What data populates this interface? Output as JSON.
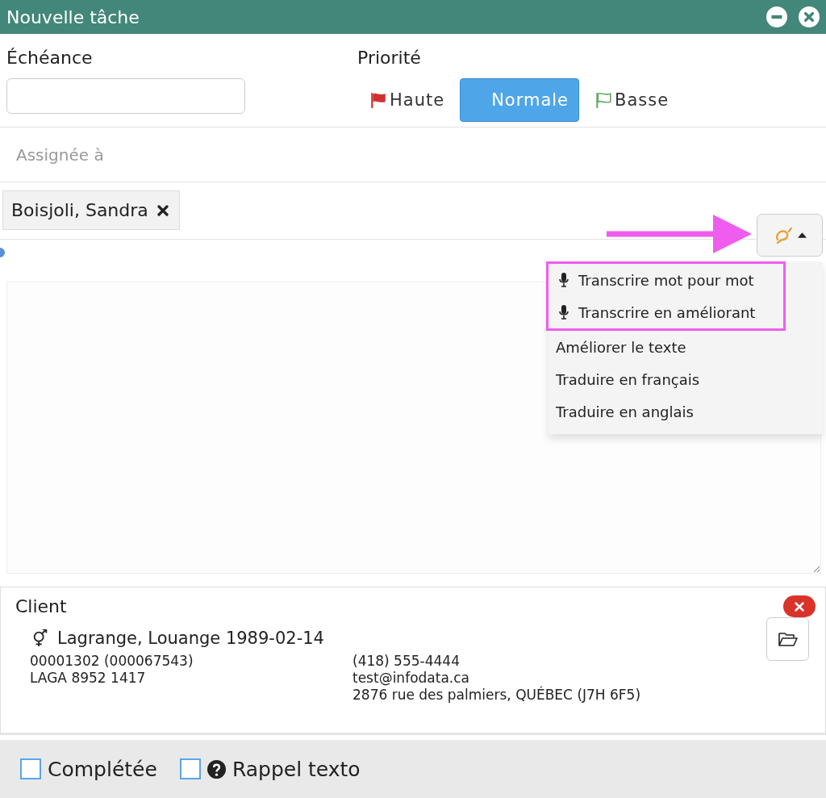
{
  "window": {
    "title": "Nouvelle tâche"
  },
  "due": {
    "label": "Échéance"
  },
  "priority": {
    "label": "Priorité",
    "options": [
      {
        "label": "Haute",
        "kind": "high",
        "selected": false
      },
      {
        "label": "Normale",
        "kind": "normal",
        "selected": true
      },
      {
        "label": "Basse",
        "kind": "low",
        "selected": false
      }
    ]
  },
  "assignee": {
    "placeholder": "Assignée à",
    "tags": [
      {
        "label": "Boisjoli, Sandra"
      }
    ]
  },
  "ai_menu": {
    "expanded": true,
    "annotation_arrow": true,
    "items": [
      {
        "label": "Transcrire mot pour mot",
        "kind": "voice",
        "highlighted": true
      },
      {
        "label": "Transcrire en améliorant",
        "kind": "voice",
        "highlighted": true
      },
      {
        "label": "Améliorer le texte",
        "kind": "text",
        "highlighted": false
      },
      {
        "label": "Traduire en français",
        "kind": "text",
        "highlighted": false
      },
      {
        "label": "Traduire en anglais",
        "kind": "text",
        "highlighted": false
      }
    ]
  },
  "client": {
    "title": "Client",
    "name": "Lagrange, Louange 1989-02-14",
    "left_lines": [
      "00001302 (000067543)",
      "LAGA 8952 1417"
    ],
    "right_lines": [
      "(418) 555-4444",
      "test@infodata.ca",
      "2876 rue des palmiers, QUÉBEC (J7H 6F5)"
    ]
  },
  "footer": {
    "checkboxes": [
      {
        "label": "Complétée",
        "checked": false,
        "help": false
      },
      {
        "label": "Rappel texto",
        "checked": false,
        "help": true
      }
    ]
  }
}
